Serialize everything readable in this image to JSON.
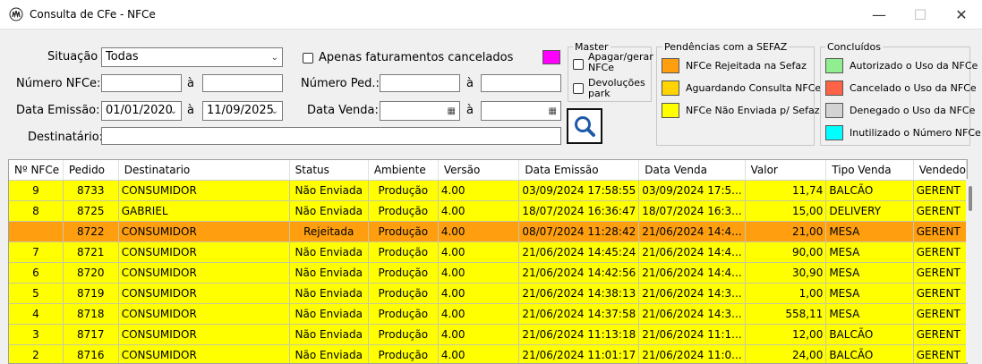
{
  "window": {
    "title": "Consulta de CFe - NFCe",
    "minimize": "—",
    "maximize": "☐",
    "close": "✕"
  },
  "filters": {
    "situacao_label": "Situação",
    "situacao_value": "Todas",
    "apenas_cancelados_label": "Apenas faturamentos cancelados",
    "numero_nfce_label": "Número NFCe:",
    "numero_nfce_from": "",
    "numero_nfce_to": "",
    "a1": "à",
    "numero_ped_label": "Número Ped.:",
    "numero_ped_from": "",
    "numero_ped_to": "",
    "a2": "à",
    "data_emissao_label": "Data Emissão:",
    "data_emissao_from": "01/01/2020",
    "data_emissao_to": "11/09/2025",
    "a3": "à",
    "data_venda_label": "Data Venda:",
    "data_venda_from": "",
    "data_venda_to": "",
    "a4": "à",
    "destinatario_label": "Destinatário:",
    "destinatario_value": ""
  },
  "master": {
    "title": "Master",
    "apagar_label": "Apagar/gerar NFCe",
    "devolucoes_label": "Devoluções park",
    "color": "#ff00ff"
  },
  "pendencias": {
    "title": "Pendências com a SEFAZ",
    "items": [
      {
        "label": "NFCe Rejeitada na Sefaz",
        "color": "#ff9f0f"
      },
      {
        "label": "Aguardando Consulta NFCe",
        "color": "#ffd400"
      },
      {
        "label": "NFCe Não Enviada p/ Sefaz",
        "color": "#ffff00"
      }
    ]
  },
  "concluidos": {
    "title": "Concluídos",
    "items": [
      {
        "label": "Autorizado o Uso da NFCe",
        "color": "#90ee90"
      },
      {
        "label": "Cancelado o Uso da NFCe",
        "color": "#ff6347"
      },
      {
        "label": "Denegado o Uso da NFCe",
        "color": "#d3d3d3"
      },
      {
        "label": "Inutilizado o Número NFCe",
        "color": "#00ffff"
      }
    ]
  },
  "table": {
    "columns": [
      "Nº NFCe",
      "Pedido",
      "Destinatario",
      "Status",
      "Ambiente",
      "Versão",
      "Data Emissão",
      "Data Venda",
      "Valor",
      "Tipo Venda",
      "Vendedo"
    ],
    "rows": [
      {
        "nfce": "9",
        "pedido": "8733",
        "dest": "CONSUMIDOR",
        "status": "Não Enviada",
        "amb": "Produção",
        "versao": "4.00",
        "emissao": "03/09/2024 17:58:55",
        "venda": "03/09/2024 17:5...",
        "valor": "11,74",
        "tipo": "BALCÃO",
        "vendedor": "GERENT",
        "color": "#ffff00"
      },
      {
        "nfce": "8",
        "pedido": "8725",
        "dest": "GABRIEL",
        "status": "Não Enviada",
        "amb": "Produção",
        "versao": "4.00",
        "emissao": "18/07/2024 16:36:47",
        "venda": "18/07/2024 16:3...",
        "valor": "15,00",
        "tipo": "DELIVERY",
        "vendedor": "GERENT",
        "color": "#ffff00"
      },
      {
        "nfce": "",
        "pedido": "8722",
        "dest": "CONSUMIDOR",
        "status": "Rejeitada",
        "amb": "Produção",
        "versao": "4.00",
        "emissao": "08/07/2024 11:28:42",
        "venda": "21/06/2024 14:4...",
        "valor": "21,00",
        "tipo": "MESA",
        "vendedor": "GERENT",
        "color": "#ff9f0f"
      },
      {
        "nfce": "7",
        "pedido": "8721",
        "dest": "CONSUMIDOR",
        "status": "Não Enviada",
        "amb": "Produção",
        "versao": "4.00",
        "emissao": "21/06/2024 14:45:24",
        "venda": "21/06/2024 14:4...",
        "valor": "90,00",
        "tipo": "MESA",
        "vendedor": "GERENT",
        "color": "#ffff00"
      },
      {
        "nfce": "6",
        "pedido": "8720",
        "dest": "CONSUMIDOR",
        "status": "Não Enviada",
        "amb": "Produção",
        "versao": "4.00",
        "emissao": "21/06/2024 14:42:56",
        "venda": "21/06/2024 14:4...",
        "valor": "30,90",
        "tipo": "MESA",
        "vendedor": "GERENT",
        "color": "#ffff00"
      },
      {
        "nfce": "5",
        "pedido": "8719",
        "dest": "CONSUMIDOR",
        "status": "Não Enviada",
        "amb": "Produção",
        "versao": "4.00",
        "emissao": "21/06/2024 14:38:13",
        "venda": "21/06/2024 14:3...",
        "valor": "1,00",
        "tipo": "MESA",
        "vendedor": "GERENT",
        "color": "#ffff00"
      },
      {
        "nfce": "4",
        "pedido": "8718",
        "dest": "CONSUMIDOR",
        "status": "Não Enviada",
        "amb": "Produção",
        "versao": "4.00",
        "emissao": "21/06/2024 14:37:58",
        "venda": "21/06/2024 14:3...",
        "valor": "558,11",
        "tipo": "MESA",
        "vendedor": "GERENT",
        "color": "#ffff00"
      },
      {
        "nfce": "3",
        "pedido": "8717",
        "dest": "CONSUMIDOR",
        "status": "Não Enviada",
        "amb": "Produção",
        "versao": "4.00",
        "emissao": "21/06/2024 11:13:18",
        "venda": "21/06/2024 11:1...",
        "valor": "12,00",
        "tipo": "BALCÃO",
        "vendedor": "GERENT",
        "color": "#ffff00"
      },
      {
        "nfce": "2",
        "pedido": "8716",
        "dest": "CONSUMIDOR",
        "status": "Não Enviada",
        "amb": "Produção",
        "versao": "4.00",
        "emissao": "21/06/2024 11:01:17",
        "venda": "21/06/2024 11:0...",
        "valor": "24,00",
        "tipo": "BALCÃO",
        "vendedor": "GERENT",
        "color": "#ffff00"
      }
    ]
  }
}
